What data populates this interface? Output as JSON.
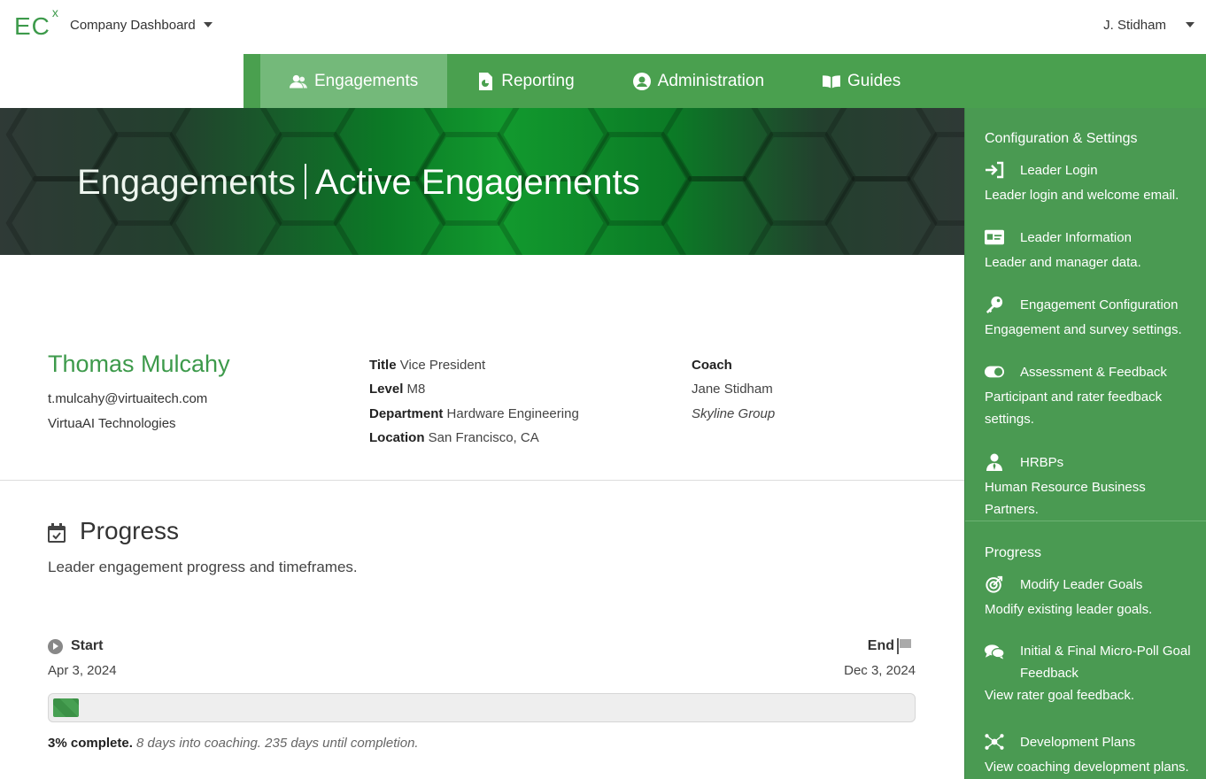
{
  "topbar": {
    "logo_text": "EC",
    "logo_sup": "x",
    "company_label": "Company Dashboard",
    "user_label": "J. Stidham"
  },
  "nav": {
    "items": [
      {
        "label": "Engagements",
        "icon": "users-icon",
        "active": true
      },
      {
        "label": "Reporting",
        "icon": "report-icon",
        "active": false
      },
      {
        "label": "Administration",
        "icon": "user-circle-icon",
        "active": false
      },
      {
        "label": "Guides",
        "icon": "book-icon",
        "active": false
      }
    ]
  },
  "hero": {
    "section": "Engagements",
    "page": "Active Engagements"
  },
  "leader": {
    "name": "Thomas Mulcahy",
    "email": "t.mulcahy@virtuaitech.com",
    "company": "VirtuaAI Technologies",
    "title_label": "Title",
    "title_value": "Vice President",
    "level_label": "Level",
    "level_value": "M8",
    "department_label": "Department",
    "department_value": "Hardware Engineering",
    "location_label": "Location",
    "location_value": "San Francisco, CA",
    "coach_label": "Coach",
    "coach_name": "Jane Stidham",
    "coach_group": "Skyline Group"
  },
  "progress": {
    "title": "Progress",
    "description": "Leader engagement progress and timeframes.",
    "start_label": "Start",
    "start_date": "Apr 3, 2024",
    "end_label": "End",
    "end_date": "Dec 3, 2024",
    "percent": 3,
    "percent_text": "3% complete.",
    "detail_text": "8 days into coaching. 235 days until completion."
  },
  "panel": {
    "config_heading": "Configuration & Settings",
    "config_items": [
      {
        "title": "Leader Login",
        "desc": "Leader login and welcome email.",
        "icon": "sign-in-icon"
      },
      {
        "title": "Leader Information",
        "desc": "Leader and manager data.",
        "icon": "id-card-icon"
      },
      {
        "title": "Engagement Configuration",
        "desc": "Engagement and survey settings.",
        "icon": "key-icon"
      },
      {
        "title": "Assessment & Feedback",
        "desc": "Participant and rater feedback settings.",
        "icon": "toggle-icon"
      },
      {
        "title": "HRBPs",
        "desc": "Human Resource Business Partners.",
        "icon": "user-tie-icon"
      }
    ],
    "progress_heading": "Progress",
    "progress_items": [
      {
        "title": "Modify Leader Goals",
        "desc": "Modify existing leader goals.",
        "icon": "target-icon"
      },
      {
        "title": "Initial & Final Micro-Poll Goal Feedback",
        "desc": "View rater goal feedback.",
        "icon": "comments-icon"
      },
      {
        "title": "Development Plans",
        "desc": "View coaching development plans.",
        "icon": "network-icon"
      }
    ]
  },
  "colors": {
    "brand_green": "#4aa04f",
    "nav_active": "#74b97a",
    "leader_name": "#3d9a4b",
    "panel_bg": "#4a9a52"
  }
}
